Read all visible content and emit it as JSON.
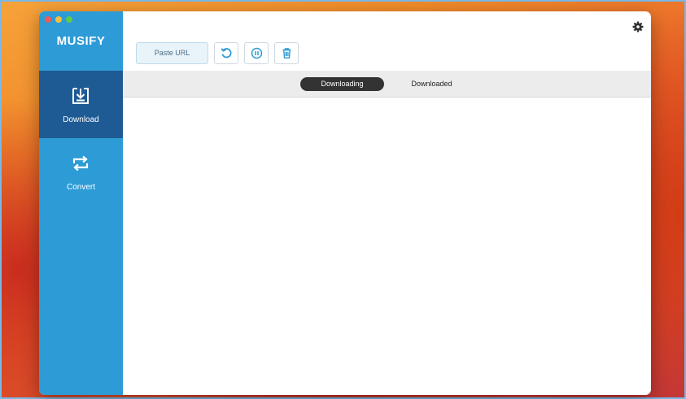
{
  "window": {
    "app_name": "MUSIFY"
  },
  "sidebar": {
    "items": [
      {
        "label": "Download",
        "icon": "download-icon",
        "active": true
      },
      {
        "label": "Convert",
        "icon": "convert-icon",
        "active": false
      }
    ]
  },
  "toolbar": {
    "paste_label": "Paste URL",
    "buttons": [
      "refresh-icon",
      "pause-icon",
      "trash-icon"
    ],
    "settings_icon": "gear-icon"
  },
  "tabs": [
    {
      "label": "Downloading",
      "active": true
    },
    {
      "label": "Downloaded",
      "active": false
    }
  ],
  "colors": {
    "sidebar": "#2d9bd6",
    "sidebar_active": "#1e5b94",
    "tab_active": "#333333",
    "accent": "#2d9bd6"
  }
}
